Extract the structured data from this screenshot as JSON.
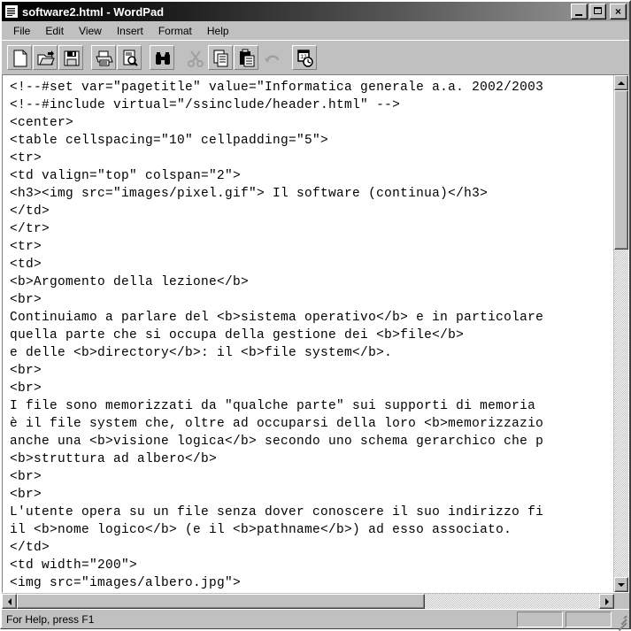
{
  "window": {
    "title": "software2.html - WordPad",
    "icon": "document-icon",
    "controls": {
      "minimize": "_",
      "maximize": "□",
      "close": "×"
    }
  },
  "menubar": {
    "items": [
      {
        "label": "File"
      },
      {
        "label": "Edit"
      },
      {
        "label": "View"
      },
      {
        "label": "Insert"
      },
      {
        "label": "Format"
      },
      {
        "label": "Help"
      }
    ]
  },
  "toolbar": {
    "buttons": [
      {
        "name": "new-icon",
        "tooltip": "New",
        "enabled": true
      },
      {
        "name": "open-folder-icon",
        "tooltip": "Open",
        "enabled": true
      },
      {
        "name": "save-floppy-icon",
        "tooltip": "Save",
        "enabled": true
      },
      {
        "name": "print-icon",
        "tooltip": "Print",
        "enabled": true
      },
      {
        "name": "print-preview-icon",
        "tooltip": "Print Preview",
        "enabled": true
      },
      {
        "name": "find-binoculars-icon",
        "tooltip": "Find",
        "enabled": true
      },
      {
        "name": "cut-scissors-icon",
        "tooltip": "Cut",
        "enabled": false
      },
      {
        "name": "copy-icon",
        "tooltip": "Copy",
        "enabled": true
      },
      {
        "name": "paste-clipboard-icon",
        "tooltip": "Paste",
        "enabled": true
      },
      {
        "name": "undo-arrow-icon",
        "tooltip": "Undo",
        "enabled": false
      },
      {
        "name": "date-time-icon",
        "tooltip": "Date/Time",
        "enabled": true
      }
    ]
  },
  "editor": {
    "lines": [
      "<!--#set var=\"pagetitle\" value=\"Informatica generale a.a. 2002/2003",
      "<!--#include virtual=\"/ssinclude/header.html\" -->",
      "<center>",
      "<table cellspacing=\"10\" cellpadding=\"5\">",
      "<tr>",
      "<td valign=\"top\" colspan=\"2\">",
      "<h3><img src=\"images/pixel.gif\"> Il software (continua)</h3>",
      "</td>",
      "</tr>",
      "<tr>",
      "<td>",
      "<b>Argomento della lezione</b>",
      "<br>",
      "Continuiamo a parlare del <b>sistema operativo</b> e in particolare",
      "quella parte che si occupa della gestione dei <b>file</b>",
      "e delle <b>directory</b>: il <b>file system</b>.",
      "<br>",
      "<br>",
      "I file sono memorizzati da \"qualche parte\" sui supporti di memoria",
      "è il file system che, oltre ad occuparsi della loro <b>memorizzazio",
      "anche una <b>visione logica</b> secondo uno schema gerarchico che p",
      "<b>struttura ad albero</b>",
      "<br>",
      "<br>",
      "L'utente opera su un file senza dover conoscere il suo indirizzo fi",
      "il <b>nome logico</b> (e il <b>pathname</b>) ad esso associato.",
      "</td>",
      "<td width=\"200\">",
      "<img src=\"images/albero.jpg\">"
    ]
  },
  "scrollbars": {
    "vertical": {
      "up_arrow": "▲",
      "down_arrow": "▼"
    },
    "horizontal": {
      "left_arrow": "◄",
      "right_arrow": "►"
    }
  },
  "statusbar": {
    "message": "For Help, press F1",
    "pane2": "",
    "pane3": ""
  },
  "colors": {
    "window_face": "#c0c0c0",
    "titlebar_start": "#000000",
    "titlebar_end": "#a8a8a8",
    "text_background": "#ffffff",
    "text_foreground": "#000000"
  }
}
